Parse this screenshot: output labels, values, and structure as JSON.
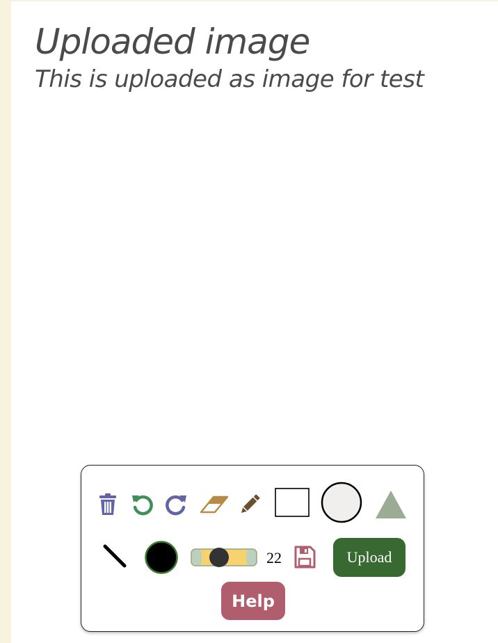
{
  "header": {
    "title": "Uploaded image",
    "subtitle": "This is uploaded as image for test"
  },
  "toolbar": {
    "tools": [
      {
        "name": "trash-icon",
        "color": "#6264a7"
      },
      {
        "name": "undo-icon",
        "color": "#3f8f5a"
      },
      {
        "name": "redo-icon",
        "color": "#6264a7"
      },
      {
        "name": "eraser-icon",
        "color": "#b98a47"
      },
      {
        "name": "pencil-icon",
        "color": "#6b4f2f"
      },
      {
        "name": "rectangle-tool",
        "color": "#ffffff"
      },
      {
        "name": "circle-tool",
        "color": "#f1eeee"
      },
      {
        "name": "triangle-tool",
        "color": "#9aac94"
      },
      {
        "name": "line-tool",
        "color": "#000000"
      },
      {
        "name": "color-picker",
        "color": "#000000"
      },
      {
        "name": "stroke-size-slider",
        "color": "#f7d26e"
      },
      {
        "name": "save-icon",
        "color": "#b05d6e"
      }
    ],
    "stroke_size": "22",
    "upload_label": "Upload",
    "help_label": "Help",
    "colors": {
      "upload_bg": "#386930",
      "help_bg": "#b05d6e"
    }
  }
}
